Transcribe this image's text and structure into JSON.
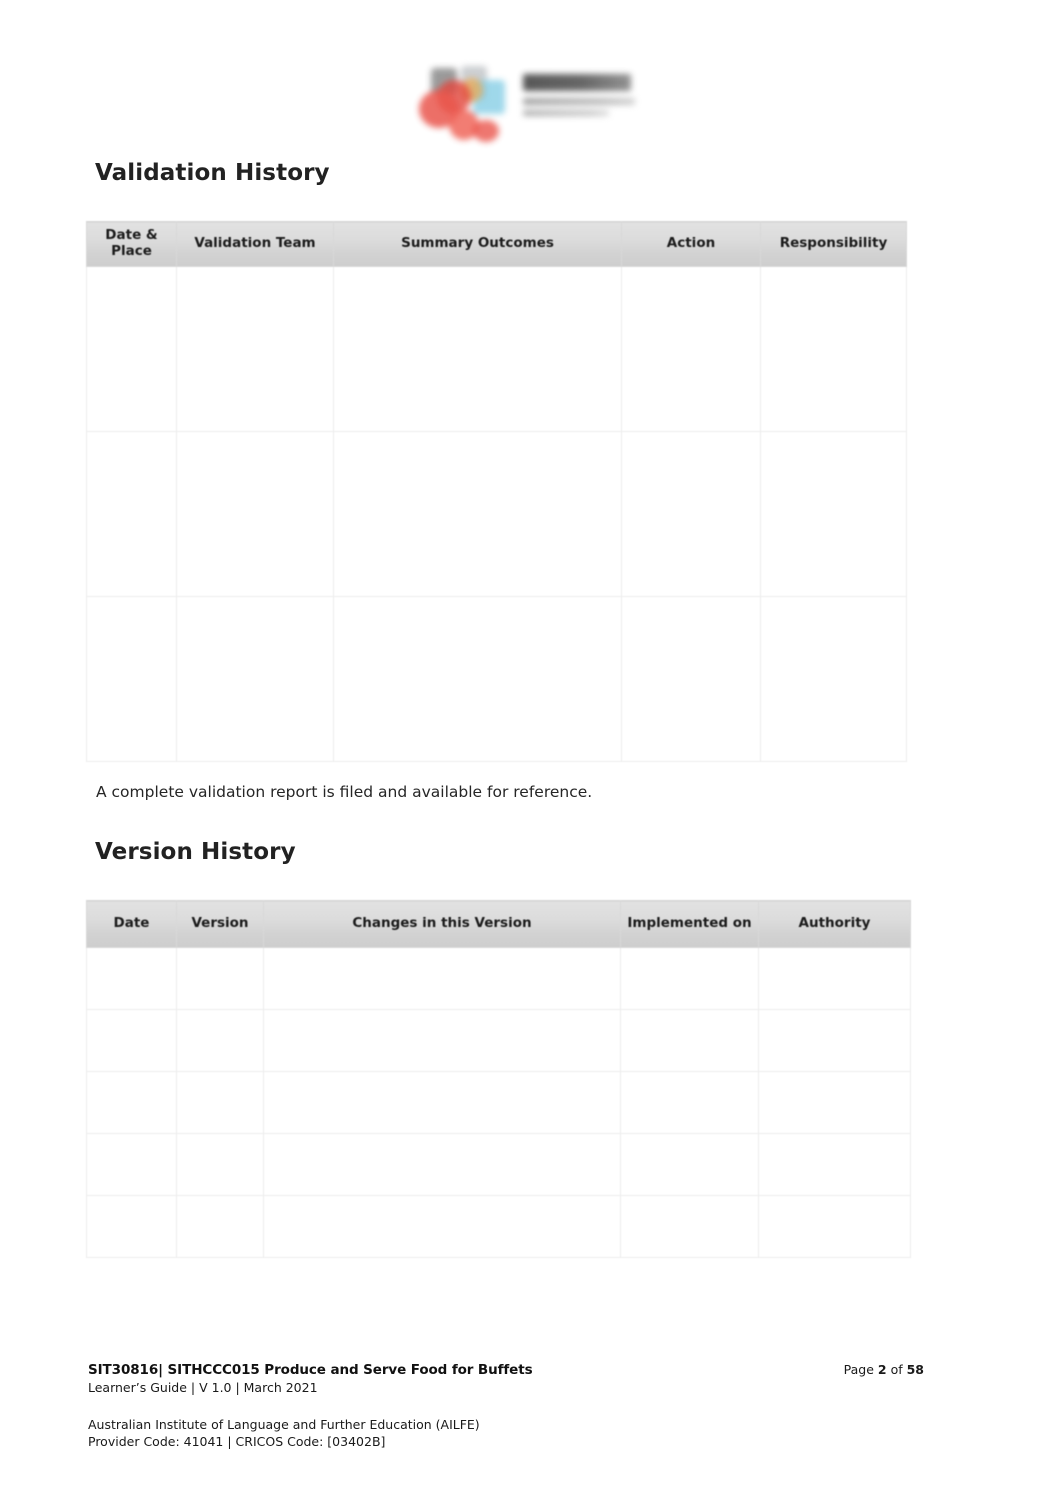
{
  "document": {
    "logo": {
      "icon_name": "ailfe-logo",
      "alt": "AILFE logo"
    },
    "sections": [
      {
        "heading": "Validation History",
        "table": {
          "columns": [
            "Date & Place",
            "Validation Team",
            "Summary Outcomes",
            "Action",
            "Responsibility"
          ],
          "rows": [
            [
              "",
              "",
              "",
              "",
              ""
            ],
            [
              "",
              "",
              "",
              "",
              ""
            ],
            [
              "",
              "",
              "",
              "",
              ""
            ]
          ]
        },
        "note": "A complete validation report is filed and available for reference."
      },
      {
        "heading": "Version History",
        "table": {
          "columns": [
            "Date",
            "Version",
            "Changes in this Version",
            "Implemented on",
            "Authority"
          ],
          "rows": [
            [
              "",
              "",
              "",
              "",
              ""
            ],
            [
              "",
              "",
              "",
              "",
              ""
            ],
            [
              "",
              "",
              "",
              "",
              ""
            ],
            [
              "",
              "",
              "",
              "",
              ""
            ],
            [
              "",
              "",
              "",
              "",
              ""
            ]
          ]
        }
      }
    ],
    "footer": {
      "course_code_title": "SIT30816| SITHCCC015 Produce and Serve Food for Buffets",
      "guide_line": "Learner’s Guide | V 1.0 | March 2021",
      "page_prefix": "Page ",
      "page_number": "2",
      "page_of": " of ",
      "page_total": "58",
      "institute": "Australian Institute of Language and Further Education (AILFE)",
      "provider": "Provider Code: 41041 | CRICOS Code: [03402B]"
    }
  }
}
